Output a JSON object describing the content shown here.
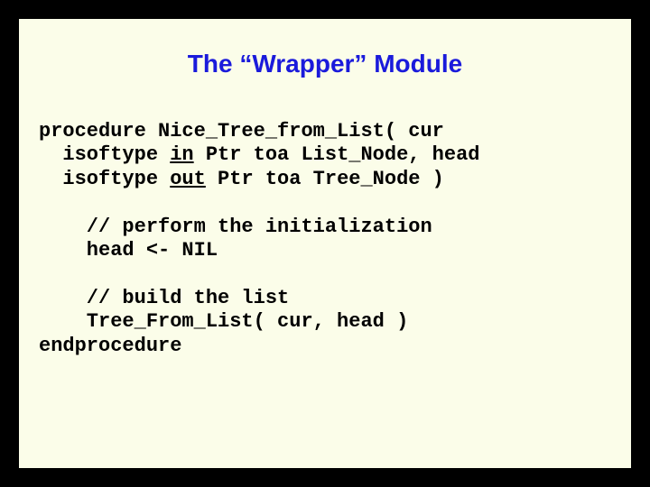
{
  "title": "The “Wrapper” Module",
  "code": {
    "l1a": "procedure Nice_Tree_from_List( cur",
    "l2a": "  isoftype ",
    "l2b": "in",
    "l2c": " Ptr toa List_Node, head",
    "l3a": "  isoftype ",
    "l3b": "out",
    "l3c": " Ptr toa Tree_Node )",
    "blank1": "",
    "l4": "    // perform the initialization",
    "l5": "    head <- NIL",
    "blank2": "",
    "l6": "    // build the list",
    "l7": "    Tree_From_List( cur, head )",
    "l8": "endprocedure"
  }
}
